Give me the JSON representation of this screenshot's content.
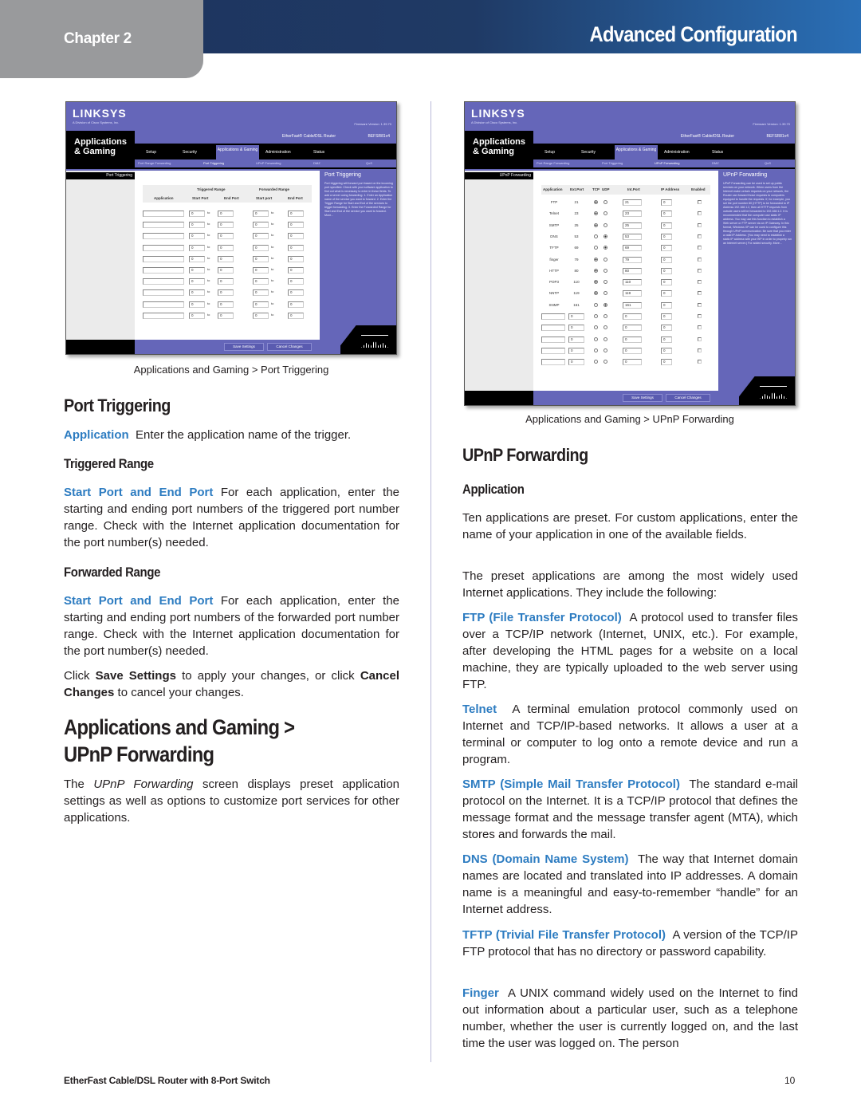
{
  "header": {
    "chapter": "Chapter 2",
    "title": "Advanced Configuration"
  },
  "screenshot_left": {
    "logo": "LINKSYS",
    "logo_sub": "A Division of Cisco Systems, Inc.",
    "firmware": "Firmware Version: 1.39.70",
    "product": "EtherFast® Cable/DSL Router",
    "model": "BEFSR81v4",
    "section": "Applications & Gaming",
    "tabs": [
      "Setup",
      "Security",
      "Applications & Gaming",
      "Administration",
      "Status"
    ],
    "subtabs": [
      "Port Range Forwarding",
      "Port Triggering",
      "UPnP Forwarding",
      "DMZ",
      "QoS"
    ],
    "nav_label": "Port Triggering",
    "group_headers": [
      "Triggered Range",
      "Forwarded Range"
    ],
    "columns": [
      "Application",
      "Start Port",
      "End Port",
      "Start port",
      "End Port"
    ],
    "to_label": "to",
    "rows": [
      {
        "app": "",
        "t_start": "0",
        "t_end": "0",
        "f_start": "0",
        "f_end": "0"
      },
      {
        "app": "",
        "t_start": "0",
        "t_end": "0",
        "f_start": "0",
        "f_end": "0"
      },
      {
        "app": "",
        "t_start": "0",
        "t_end": "0",
        "f_start": "0",
        "f_end": "0"
      },
      {
        "app": "",
        "t_start": "0",
        "t_end": "0",
        "f_start": "0",
        "f_end": "0"
      },
      {
        "app": "",
        "t_start": "0",
        "t_end": "0",
        "f_start": "0",
        "f_end": "0"
      },
      {
        "app": "",
        "t_start": "0",
        "t_end": "0",
        "f_start": "0",
        "f_end": "0"
      },
      {
        "app": "",
        "t_start": "0",
        "t_end": "0",
        "f_start": "0",
        "f_end": "0"
      },
      {
        "app": "",
        "t_start": "0",
        "t_end": "0",
        "f_start": "0",
        "f_end": "0"
      },
      {
        "app": "",
        "t_start": "0",
        "t_end": "0",
        "f_start": "0",
        "f_end": "0"
      },
      {
        "app": "",
        "t_start": "0",
        "t_end": "0",
        "f_start": "0",
        "f_end": "0"
      }
    ],
    "help_title": "Port Triggering",
    "help_text": "Port triggering will forward port based on the incoming port specified. Check with your software application to find out what is necessary to enter in these fields. To add a server using forwarding: 1. Enter an Application name of the service you want to forward. 2. Enter the Trigger Range for Start and End of the services to trigger forwarding. 3. Enter the Forwarded Range for Start and End of the service you want to forward. More...",
    "save_button": "Save Settings",
    "cancel_button": "Cancel Changes",
    "caption": "Applications and Gaming > Port Triggering"
  },
  "screenshot_right": {
    "logo": "LINKSYS",
    "logo_sub": "A Division of Cisco Systems, Inc.",
    "firmware": "Firmware Version: 1.39.70",
    "product": "EtherFast® Cable/DSL Router",
    "model": "BEFSR81v4",
    "section": "Applications & Gaming",
    "tabs": [
      "Setup",
      "Security",
      "Applications & Gaming",
      "Administration",
      "Status"
    ],
    "subtabs": [
      "Port Range Forwarding",
      "Port Triggering",
      "UPnP Forwarding",
      "DMZ",
      "QoS"
    ],
    "nav_label": "UPnP Forwarding",
    "columns": [
      "Application",
      "Ext.Port",
      "TCP",
      "UDP",
      "Int.Port",
      "IP Address",
      "Enabled"
    ],
    "rows": [
      {
        "app": "FTP",
        "ext": "21",
        "tcp": true,
        "udp": false,
        "int": "21",
        "ip": "0",
        "enabled": false
      },
      {
        "app": "Telnet",
        "ext": "23",
        "tcp": true,
        "udp": false,
        "int": "23",
        "ip": "0",
        "enabled": false
      },
      {
        "app": "SMTP",
        "ext": "25",
        "tcp": true,
        "udp": false,
        "int": "25",
        "ip": "0",
        "enabled": false
      },
      {
        "app": "DNS",
        "ext": "53",
        "tcp": false,
        "udp": true,
        "int": "53",
        "ip": "0",
        "enabled": false
      },
      {
        "app": "TFTP",
        "ext": "69",
        "tcp": false,
        "udp": true,
        "int": "69",
        "ip": "0",
        "enabled": false
      },
      {
        "app": "finger",
        "ext": "79",
        "tcp": true,
        "udp": false,
        "int": "79",
        "ip": "0",
        "enabled": false
      },
      {
        "app": "HTTP",
        "ext": "80",
        "tcp": true,
        "udp": false,
        "int": "80",
        "ip": "0",
        "enabled": false
      },
      {
        "app": "POP3",
        "ext": "110",
        "tcp": true,
        "udp": false,
        "int": "110",
        "ip": "0",
        "enabled": false
      },
      {
        "app": "NNTP",
        "ext": "119",
        "tcp": true,
        "udp": false,
        "int": "119",
        "ip": "0",
        "enabled": false
      },
      {
        "app": "SNMP",
        "ext": "161",
        "tcp": false,
        "udp": true,
        "int": "161",
        "ip": "0",
        "enabled": false
      }
    ],
    "custom_rows": [
      {
        "app": "",
        "ext": "0",
        "int": "0",
        "ip": "0"
      },
      {
        "app": "",
        "ext": "0",
        "int": "0",
        "ip": "0"
      },
      {
        "app": "",
        "ext": "0",
        "int": "0",
        "ip": "0"
      },
      {
        "app": "",
        "ext": "0",
        "int": "0",
        "ip": "0"
      },
      {
        "app": "",
        "ext": "0",
        "int": "0",
        "ip": "0"
      }
    ],
    "help_title": "UPnP Forwarding",
    "help_text": "UPnP Forwarding can be used to set up public services on your network. When users from the Internet make certain requests on your network, the Router can forward those requests to computers equipped to handle the requests. If, for example, you set the port number 80 (HTTP) to be forwarded to IP Address 192.168.1.2, then all HTTP requests from outside users will be forwarded to 192.168.1.2. It is recommended that the computer use static IP address. You may use this function to establish a Web server or FTP server via an IP Gateway. In this format, Windows XP can be used to configure this through UPnP communication. Be sure that you enter a valid IP Address. (You may need to establish a static IP address with your ISP in order to properly run an Internet server.) For added security. More...",
    "save_button": "Save Settings",
    "cancel_button": "Cancel Changes",
    "caption": "Applications and Gaming > UPnP Forwarding"
  },
  "left_column": {
    "port_triggering_heading": "Port Triggering",
    "application_term": "Application",
    "application_text": "Enter the application name of the trigger.",
    "triggered_range_heading": "Triggered Range",
    "triggered_term": "Start Port and End Port",
    "triggered_text": "For each application, enter the starting and ending port numbers of the triggered port number range. Check with the Internet application documentation for the port number(s) needed.",
    "forwarded_range_heading": "Forwarded Range",
    "forwarded_term": "Start Port and End Port",
    "forwarded_text": "For each application,  enter the starting and ending port numbers of the forwarded port number range. Check with the Internet application documentation for the port number(s) needed.",
    "save_pre": "Click ",
    "save_bold": "Save Settings",
    "save_mid": " to apply your changes, or click ",
    "cancel_bold": "Cancel Changes",
    "save_post": " to cancel your changes.",
    "upnp_section_heading": "Applications and Gaming > UPnP Forwarding",
    "upnp_intro_pre": "The ",
    "upnp_intro_italic": "UPnP Forwarding",
    "upnp_intro_post": " screen displays preset application settings as well as options to customize port services for other applications."
  },
  "right_column": {
    "upnp_heading": "UPnP Forwarding",
    "application_heading": "Application",
    "para1": "Ten applications are preset. For custom applications, enter the name of your application in one of the available fields.",
    "para2": "The preset applications are among the most widely used Internet applications. They include the following:",
    "definitions": [
      {
        "term": "FTP (File Transfer Protocol)",
        "text": "A protocol used to transfer files over a TCP/IP network (Internet, UNIX, etc.). For example, after developing the HTML pages for a website on a local machine, they are typically uploaded to the web server using FTP."
      },
      {
        "term": "Telnet",
        "text": "A terminal emulation protocol commonly used on Internet and TCP/IP-based networks. It allows a user at a terminal or computer to log onto a remote device and run a program."
      },
      {
        "term": "SMTP (Simple Mail Transfer Protocol)",
        "text": "The standard e-mail protocol on the Internet. It is a TCP/IP protocol that defines the message format and the message transfer agent (MTA), which stores and forwards the mail."
      },
      {
        "term": "DNS (Domain Name System)",
        "text": "The way that Internet domain names are located and translated into IP addresses. A domain name is a meaningful and easy-to-remember “handle” for an Internet address."
      },
      {
        "term": "TFTP (Trivial File Transfer Protocol)",
        "text": "A version of the TCP/IP FTP protocol that has no directory or password capability."
      },
      {
        "term": "Finger",
        "text": "A UNIX command widely used on the Internet to find out information about a particular user, such as a telephone number, whether the user is currently logged on, and the last time the user was logged on. The person"
      }
    ]
  },
  "footer": {
    "product": "EtherFast Cable/DSL Router with 8-Port Switch",
    "page_number": "10"
  }
}
